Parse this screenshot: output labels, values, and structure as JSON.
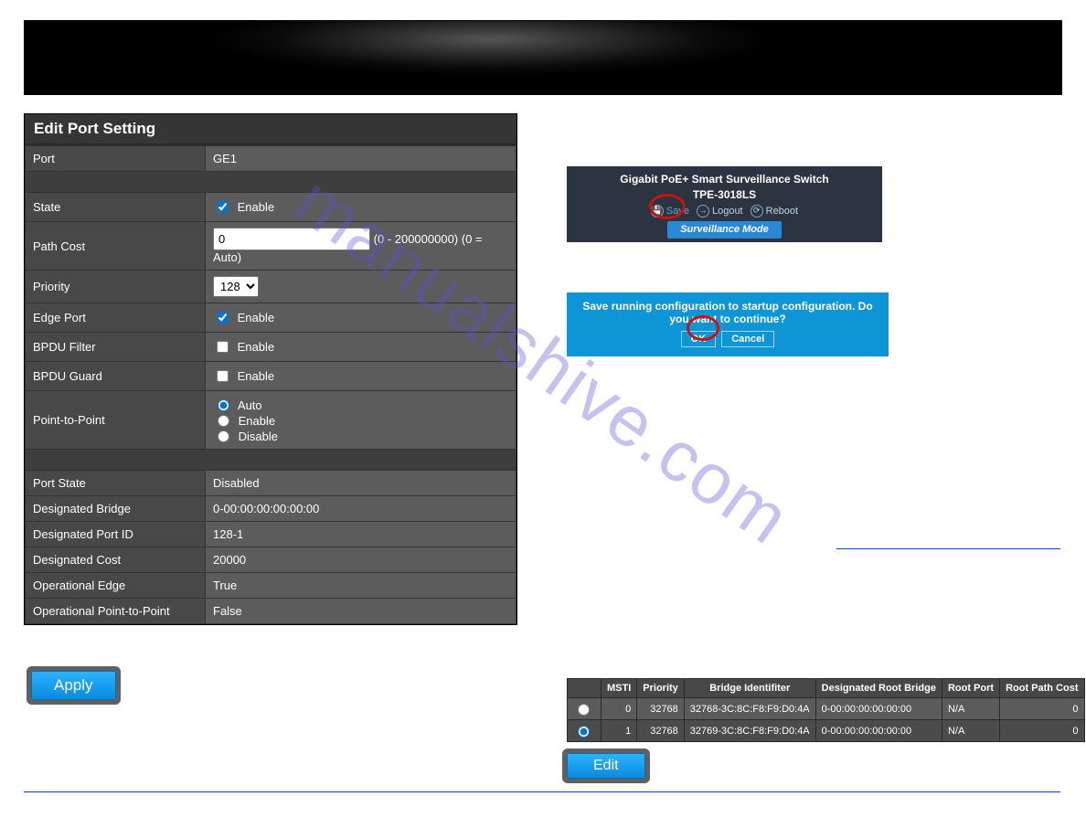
{
  "watermark": "manualshive.com",
  "panel": {
    "title": "Edit Port Setting",
    "port_label": "Port",
    "port_value": "GE1",
    "state_label": "State",
    "state_enable": "Enable",
    "state_checked": true,
    "pathcost_label": "Path Cost",
    "pathcost_value": "0",
    "pathcost_hint": "(0 - 200000000) (0 = Auto)",
    "priority_label": "Priority",
    "priority_value": "128",
    "edgeport_label": "Edge Port",
    "edgeport_enable": "Enable",
    "edgeport_checked": true,
    "bpdufilter_label": "BPDU Filter",
    "bpdufilter_enable": "Enable",
    "bpdufilter_checked": false,
    "bpduguard_label": "BPDU Guard",
    "bpduguard_enable": "Enable",
    "bpduguard_checked": false,
    "ptp_label": "Point-to-Point",
    "ptp_auto": "Auto",
    "ptp_enable": "Enable",
    "ptp_disable": "Disable",
    "portstate_label": "Port State",
    "portstate_value": "Disabled",
    "desbridge_label": "Designated Bridge",
    "desbridge_value": "0-00:00:00:00:00:00",
    "desportid_label": "Designated Port ID",
    "desportid_value": "128-1",
    "descost_label": "Designated Cost",
    "descost_value": "20000",
    "opedge_label": "Operational Edge",
    "opedge_value": "True",
    "opptp_label": "Operational Point-to-Point",
    "opptp_value": "False"
  },
  "buttons": {
    "apply": "Apply",
    "edit": "Edit"
  },
  "device_header": {
    "title": "Gigabit PoE+ Smart Surveillance Switch",
    "model": "TPE-3018LS",
    "save": "Save",
    "logout": "Logout",
    "reboot": "Reboot",
    "mode": "Surveillance Mode"
  },
  "confirm": {
    "message": "Save running configuration to startup configuration. Do you want to continue?",
    "ok": "OK",
    "cancel": "Cancel"
  },
  "msti": {
    "headers": {
      "msti": "MSTI",
      "priority": "Priority",
      "bridgeid": "Bridge Identifiter",
      "desroot": "Designated Root Bridge",
      "rootport": "Root Port",
      "rootpathcost": "Root Path Cost"
    },
    "rows": [
      {
        "sel": false,
        "msti": "0",
        "priority": "32768",
        "bridgeid": "32768-3C:8C:F8:F9:D0:4A",
        "desroot": "0-00:00:00:00:00:00",
        "rootport": "N/A",
        "rootpathcost": "0"
      },
      {
        "sel": true,
        "msti": "1",
        "priority": "32768",
        "bridgeid": "32769-3C:8C:F8:F9:D0:4A",
        "desroot": "0-00:00:00:00:00:00",
        "rootport": "N/A",
        "rootpathcost": "0"
      }
    ]
  }
}
